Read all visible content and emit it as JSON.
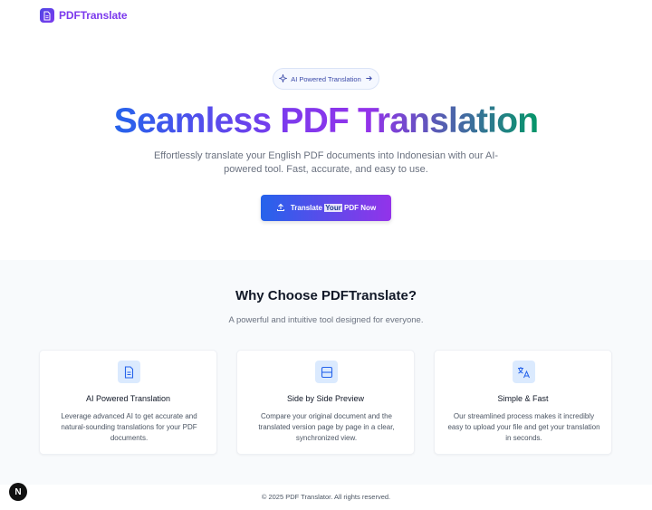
{
  "header": {
    "brand": "PDFTranslate",
    "logo_icon": "document-icon"
  },
  "hero": {
    "pill_label": "AI Powered Translation",
    "pill_icon": "sparkle-icon",
    "pill_arrow": "arrow-right-icon",
    "title": "Seamless PDF Translation",
    "subtitle": "Effortlessly translate your English PDF documents into Indonesian with our AI-powered tool. Fast, accurate, and easy to use.",
    "cta_icon": "upload-icon",
    "cta_pre": "Translate ",
    "cta_highlight": "Your",
    "cta_post": " PDF Now"
  },
  "features": {
    "title": "Why Choose PDFTranslate?",
    "subtitle": "A powerful and intuitive tool designed for everyone.",
    "cards": [
      {
        "icon": "document-icon",
        "title": "AI Powered Translation",
        "desc": "Leverage advanced AI to get accurate and natural-sounding translations for your PDF documents."
      },
      {
        "icon": "split-view-icon",
        "title": "Side by Side Preview",
        "desc": "Compare your original document and the translated version page by page in a clear, synchronized view."
      },
      {
        "icon": "translate-icon",
        "title": "Simple & Fast",
        "desc": "Our streamlined process makes it incredibly easy to upload your file and get your translation in seconds."
      }
    ]
  },
  "footer": {
    "copyright": "© 2025 PDF Translator. All rights reserved.",
    "badge": "N"
  },
  "colors": {
    "brand": "#7c3aed",
    "accent_blue": "#2563eb",
    "accent_green": "#059669",
    "icon_bg": "#dbeafe"
  }
}
